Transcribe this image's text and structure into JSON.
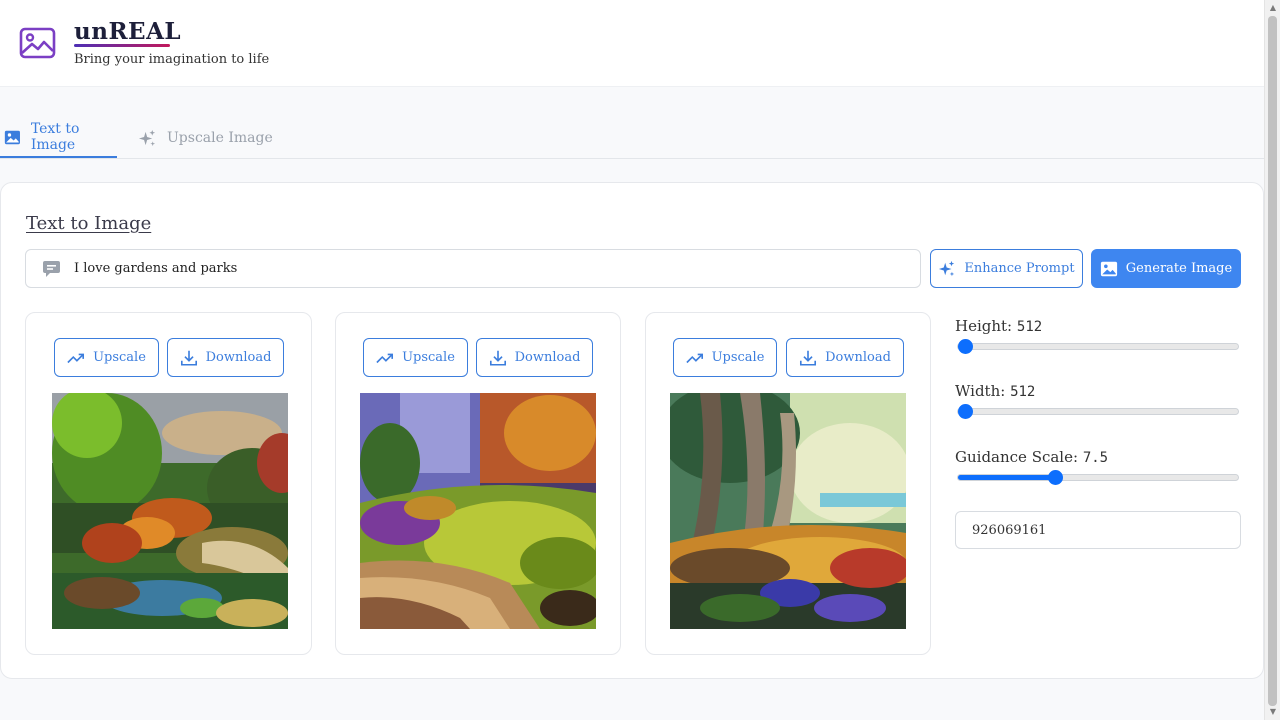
{
  "header": {
    "title": "unREAL",
    "subtitle": "Bring your imagination to life"
  },
  "tabs": [
    {
      "label": "Text to Image",
      "active": true,
      "icon": "image-icon"
    },
    {
      "label": "Upscale Image",
      "active": false,
      "icon": "sparkles-icon"
    }
  ],
  "main": {
    "section_title": "Text to Image",
    "prompt": {
      "value": "I love gardens and parks",
      "icon": "chat-icon"
    },
    "enhance_label": "Enhance Prompt",
    "generate_label": "Generate Image",
    "results": [
      {
        "upscale_label": "Upscale",
        "download_label": "Download",
        "image": "garden-painting"
      },
      {
        "upscale_label": "Upscale",
        "download_label": "Download",
        "image": "park-path-painting"
      },
      {
        "upscale_label": "Upscale",
        "download_label": "Download",
        "image": "forest-path-painting"
      }
    ]
  },
  "settings": {
    "height": {
      "label": "Height:",
      "value": "512",
      "level": 0
    },
    "width": {
      "label": "Width:",
      "value": "512",
      "level": 0
    },
    "guidance": {
      "label": "Guidance Scale:",
      "value": "7.5",
      "level": 0.34
    },
    "seed": "926069161"
  },
  "colors": {
    "accent": "#3b7ddd",
    "primary_button": "#3e86f0",
    "slider": "#0d6efd",
    "logo": "#7b3fc4"
  }
}
